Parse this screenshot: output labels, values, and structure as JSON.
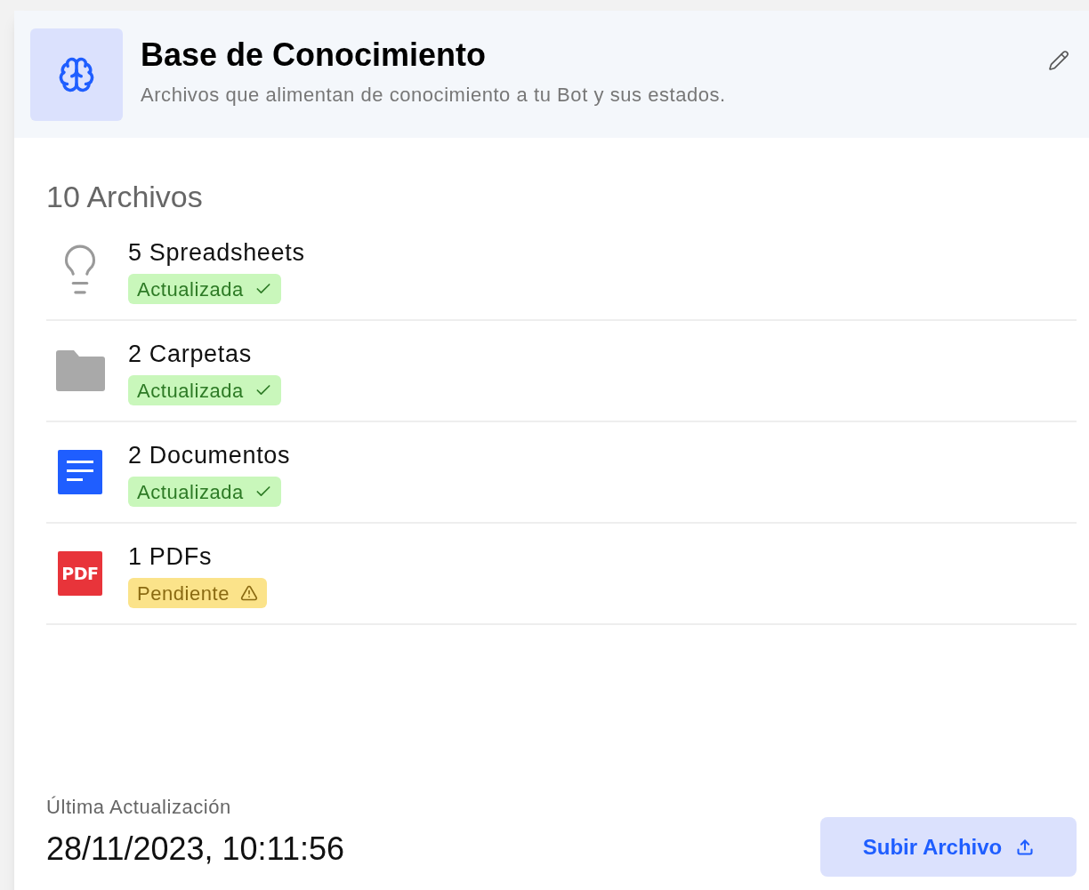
{
  "header": {
    "title": "Base de Conocimiento",
    "subtitle": "Archivos que alimentan de conocimiento a tu Bot y sus estados."
  },
  "files": {
    "count_label": "10 Archivos",
    "items": [
      {
        "kind": "lightbulb",
        "name": "5 Spreadsheets",
        "status": {
          "kind": "updated",
          "label": "Actualizada"
        }
      },
      {
        "kind": "folder",
        "name": "2 Carpetas",
        "status": {
          "kind": "updated",
          "label": "Actualizada"
        }
      },
      {
        "kind": "document",
        "name": "2 Documentos",
        "status": {
          "kind": "updated",
          "label": "Actualizada"
        }
      },
      {
        "kind": "pdf",
        "icon_label": "PDF",
        "name": "1 PDFs",
        "status": {
          "kind": "pending",
          "label": "Pendiente"
        }
      }
    ]
  },
  "footer": {
    "last_update_label": "Última Actualización",
    "last_update_value": "28/11/2023, 10:11:56",
    "upload_button": "Subir Archivo"
  }
}
